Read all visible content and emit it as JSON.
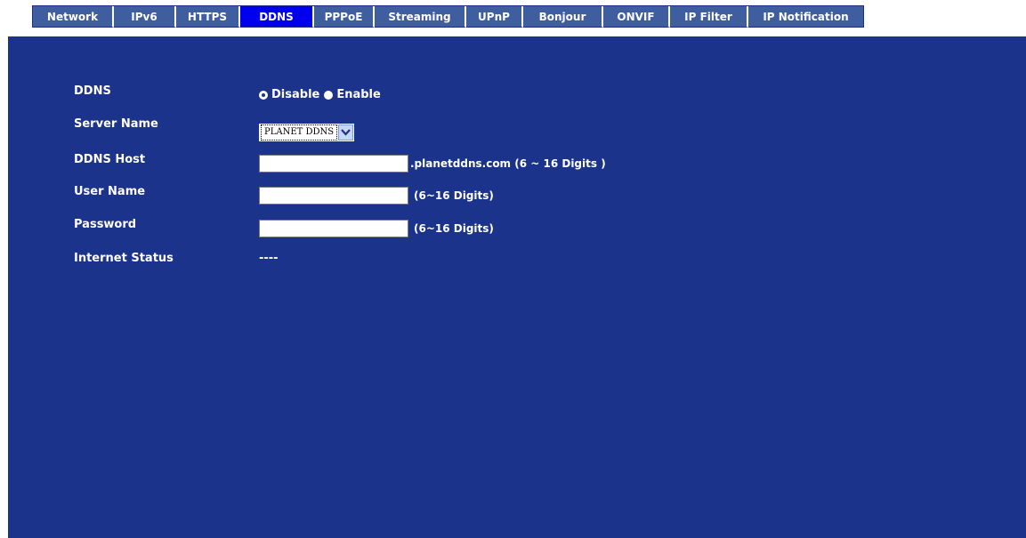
{
  "tabs": [
    {
      "label": "Network",
      "width": 91
    },
    {
      "label": "IPv6",
      "width": 70
    },
    {
      "label": "HTTPS",
      "width": 72
    },
    {
      "label": "DDNS",
      "width": 83
    },
    {
      "label": "PPPoE",
      "width": 68
    },
    {
      "label": "Streaming",
      "width": 103
    },
    {
      "label": "UPnP",
      "width": 64
    },
    {
      "label": "Bonjour",
      "width": 90
    },
    {
      "label": "ONVIF",
      "width": 75
    },
    {
      "label": "IP Filter",
      "width": 88
    },
    {
      "label": "IP Notification",
      "width": 130
    }
  ],
  "form": {
    "ddns": {
      "label": "DDNS",
      "option_disable": "Disable",
      "option_enable": "Enable",
      "selected": "Disable"
    },
    "server_name": {
      "label": "Server Name",
      "value": "PLANET DDNS"
    },
    "ddns_host": {
      "label": "DDNS Host",
      "value": "",
      "hint": ".planetddns.com (6 ~ 16 Digits )"
    },
    "user_name": {
      "label": "User Name",
      "value": "",
      "hint": "(6~16 Digits)"
    },
    "password": {
      "label": "Password",
      "value": "",
      "hint": "(6~16 Digits)"
    },
    "internet_status": {
      "label": "Internet Status",
      "value": "----"
    }
  }
}
